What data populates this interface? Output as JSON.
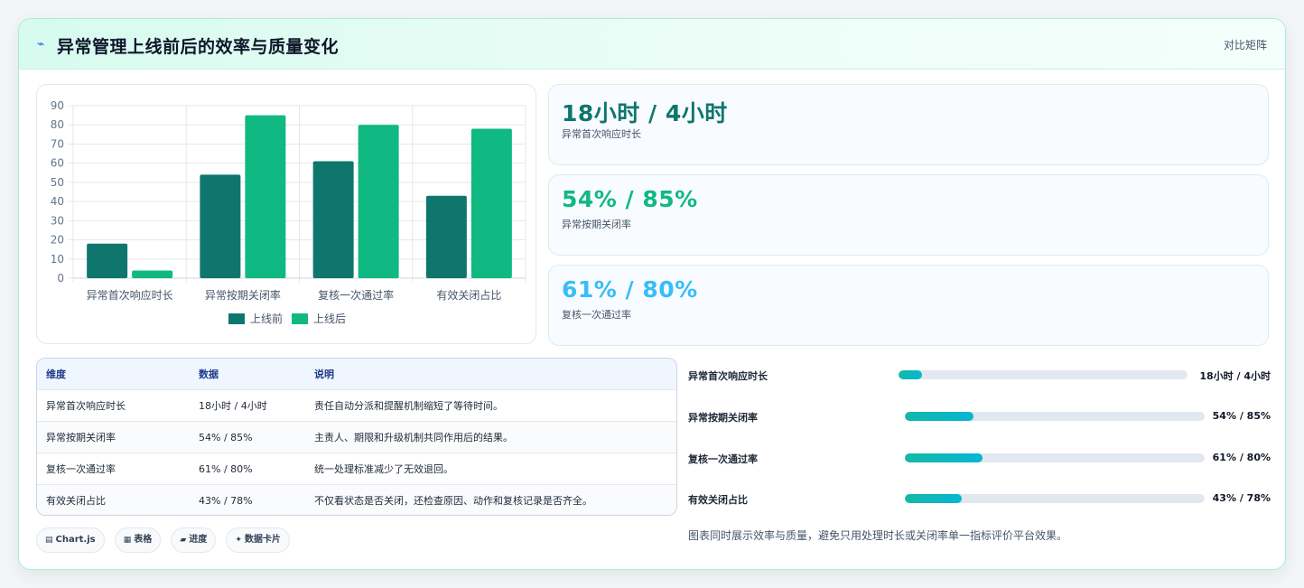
{
  "panel": {
    "title": "异常管理上线前后的效率与质量变化",
    "tag": "对比矩阵",
    "title_icon": "spark-icon"
  },
  "chart_data": {
    "type": "bar",
    "categories": [
      "异常首次响应时长",
      "异常按期关闭率",
      "复核一次通过率",
      "有效关闭占比"
    ],
    "series": [
      {
        "name": "上线前",
        "values": [
          18,
          54,
          61,
          43
        ],
        "color": "#0f766e"
      },
      {
        "name": "上线后",
        "values": [
          4,
          85,
          80,
          78
        ],
        "color": "#10b981"
      }
    ],
    "ylim": [
      0,
      90
    ],
    "yticks": [
      "0",
      "10",
      "20",
      "30",
      "40",
      "50",
      "60",
      "70",
      "80",
      "90"
    ],
    "title": "",
    "xlabel": "",
    "ylabel": "",
    "grid": true,
    "legend": "bottom-center"
  },
  "stats": [
    {
      "value": "18小时 / 4小时",
      "label": "异常首次响应时长",
      "color": "#0f766e"
    },
    {
      "value": "54% / 85%",
      "label": "异常按期关闭率",
      "color": "#10b981"
    },
    {
      "value": "61% / 80%",
      "label": "复核一次通过率",
      "color": "#38bdf8"
    }
  ],
  "table": {
    "headers": [
      "维度",
      "数据",
      "说明"
    ],
    "rows": [
      [
        "异常首次响应时长",
        "18小时 / 4小时",
        "责任自动分派和提醒机制缩短了等待时间。"
      ],
      [
        "异常按期关闭率",
        "54% / 85%",
        "主责人、期限和升级机制共同作用后的结果。"
      ],
      [
        "复核一次通过率",
        "61% / 80%",
        "统一处理标准减少了无效退回。"
      ],
      [
        "有效关闭占比",
        "43% / 78%",
        "不仅看状态是否关闭，还检查原因、动作和复核记录是否齐全。"
      ]
    ]
  },
  "progress": {
    "items": [
      {
        "label": "异常首次响应时长",
        "value_text": "18小时 / 4小时",
        "fill": 0.08
      },
      {
        "label": "异常按期关闭率",
        "value_text": "54% / 85%",
        "fill": 0.23
      },
      {
        "label": "复核一次通过率",
        "value_text": "61% / 80%",
        "fill": 0.26
      },
      {
        "label": "有效关闭占比",
        "value_text": "43% / 78%",
        "fill": 0.19
      }
    ],
    "note": "图表同时展示效率与质量，避免只用处理时长或关闭率单一指标评价平台效果。"
  },
  "chips": [
    {
      "icon": "▤",
      "label": "Chart.js",
      "icon_name": "chart-icon"
    },
    {
      "icon": "▦",
      "label": "表格",
      "icon_name": "table-icon"
    },
    {
      "icon": "▰",
      "label": "进度",
      "icon_name": "progress-icon"
    },
    {
      "icon": "✦",
      "label": "数据卡片",
      "icon_name": "sparkle-icon"
    }
  ]
}
